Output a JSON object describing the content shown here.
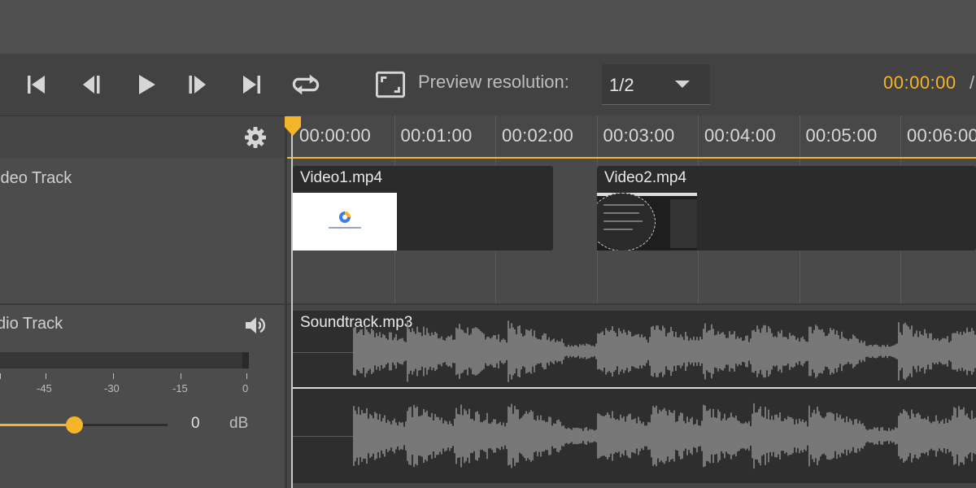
{
  "toolbar": {
    "preview_resolution_label": "Preview resolution:",
    "preview_resolution_value": "1/2",
    "current_time": "00:00:00",
    "time_separator": "/"
  },
  "timeline": {
    "ruler_ticks": [
      "00:00:00",
      "00:01:00",
      "00:02:00",
      "00:03:00",
      "00:04:00",
      "00:05:00",
      "00:06:00"
    ]
  },
  "video_track": {
    "title": "ideo Track",
    "clips": [
      {
        "name": "Video1.mp4"
      },
      {
        "name": "Video2.mp4"
      }
    ]
  },
  "audio_track": {
    "title": "dio Track",
    "clip_name": "Soundtrack.mp3",
    "meter_labels": [
      "-45",
      "-30",
      "-15",
      "0"
    ],
    "volume_value": "0",
    "volume_unit": "dB",
    "volume_fraction": 0.44
  },
  "colors": {
    "accent": "#f5b52a",
    "panel": "#4c4c4c",
    "clip": "#2b2b2b",
    "waveform": "#8a8a8a"
  }
}
